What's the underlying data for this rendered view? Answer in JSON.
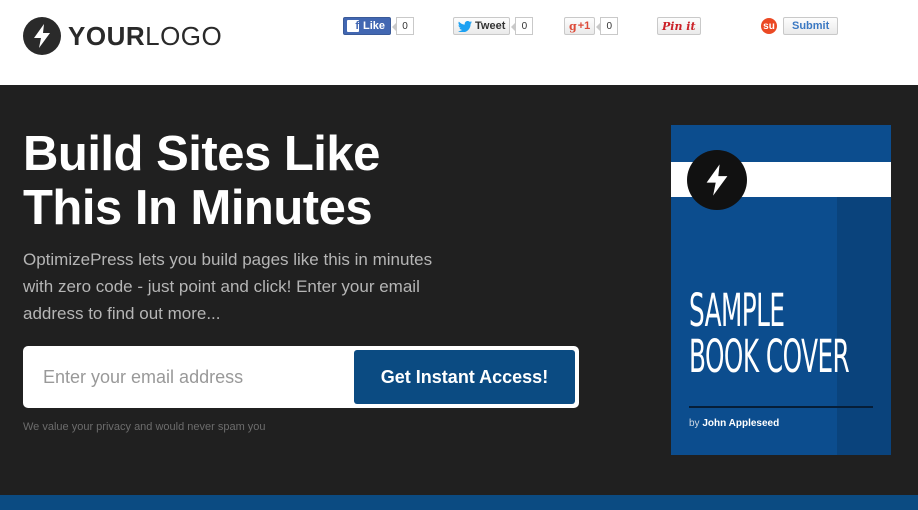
{
  "header": {
    "logo": {
      "bold": "YOUR",
      "light": "LOGO"
    },
    "share": {
      "facebook": {
        "label": "Like",
        "count": "0"
      },
      "twitter": {
        "label": "Tweet",
        "count": "0"
      },
      "google": {
        "label": "+1",
        "count": "0"
      },
      "pinterest": {
        "label": "Pin it"
      },
      "stumbleupon": {
        "label": "Submit"
      }
    }
  },
  "hero": {
    "headline_line1": "Build Sites Like",
    "headline_line2": "This In Minutes",
    "subtext": "OptimizePress lets you build pages like this in minutes with zero code - just point and click! Enter your email address to find out more...",
    "email_placeholder": "Enter your email address",
    "cta_label": "Get Instant Access!",
    "privacy": "We value your privacy and would never spam you"
  },
  "book": {
    "title_line1": "SAMPLE",
    "title_line2": "BOOK COVER",
    "author_prefix": "by",
    "author_name": "John Appleseed"
  },
  "colors": {
    "hero_bg": "#202020",
    "accent_blue": "#0b4b82",
    "book_blue": "#0c4d8e"
  },
  "icons": [
    "lightning-bolt-icon",
    "facebook-icon",
    "twitter-bird-icon",
    "stumbleupon-icon"
  ]
}
